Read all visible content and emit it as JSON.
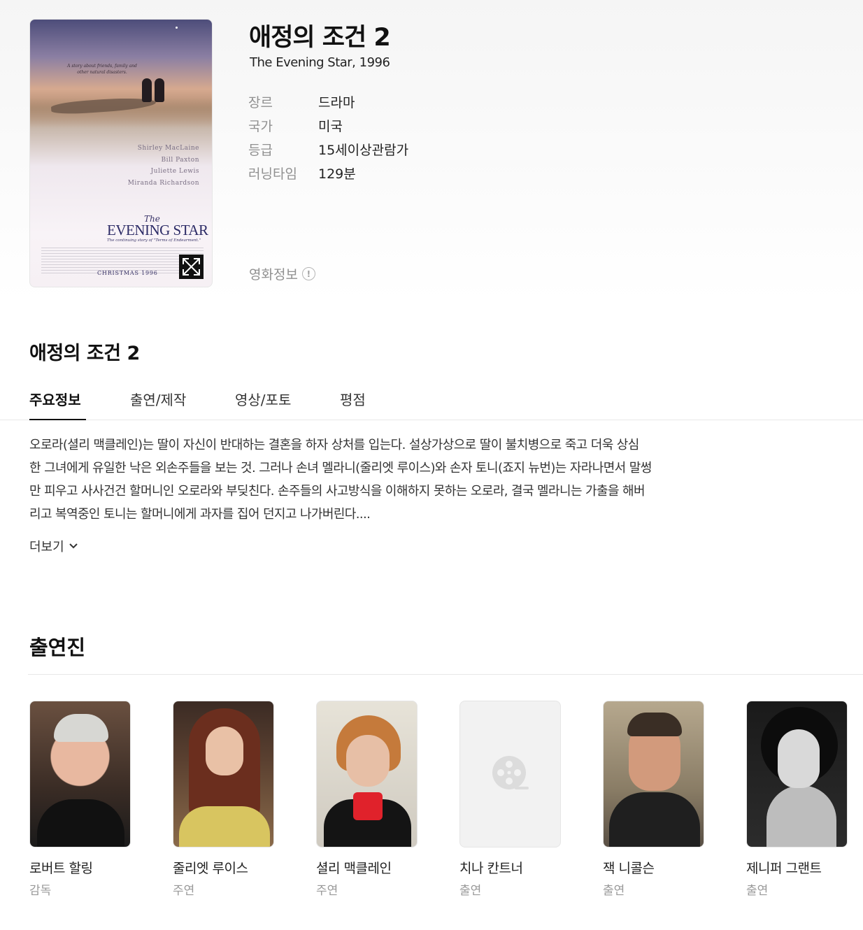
{
  "movie": {
    "title_ko": "애정의 조건 2",
    "title_en_year": "The Evening Star, 1996",
    "info": [
      {
        "key": "장르",
        "value": "드라마"
      },
      {
        "key": "국가",
        "value": "미국"
      },
      {
        "key": "등급",
        "value": "15세이상관람가"
      },
      {
        "key": "러닝타임",
        "value": "129분"
      }
    ],
    "movie_info_label": "영화정보",
    "info_icon": "!"
  },
  "poster": {
    "tagline": "A story about friends, family and other natural disasters.",
    "credits": [
      "Shirley MacLaine",
      "Bill Paxton",
      "Juliette Lewis",
      "Miranda Richardson"
    ],
    "logo_the": "The",
    "logo_main": "EVENING STAR",
    "logo_sub": "The continuing story of \"Terms of Endearment.\"",
    "release": "CHRISTMAS 1996"
  },
  "section_title": "애정의 조건 2",
  "tabs": [
    {
      "label": "주요정보",
      "active": true
    },
    {
      "label": "출연/제작",
      "active": false
    },
    {
      "label": "영상/포토",
      "active": false
    },
    {
      "label": "평점",
      "active": false
    }
  ],
  "synopsis": {
    "lines": [
      "오로라(셜리 맥클레인)는 딸이 자신이 반대하는 결혼을 하자 상처를 입는다. 설상가상으로 딸이 불치병으로 죽고 더욱 상심",
      "한 그녀에게 유일한 낙은 외손주들을 보는 것. 그러나 손녀 멜라니(줄리엣 루이스)와 손자 토니(죠지 뉴번)는 자라나면서 말썽",
      "만 피우고 사사건건 할머니인 오로라와 부딪친다. 손주들의 사고방식을 이해하지 못하는 오로라, 결국 멜라니는 가출을 해버",
      "리고 복역중인 토니는 할머니에게 과자를 집어 던지고 나가버린다...."
    ],
    "more_label": "더보기"
  },
  "cast": {
    "title": "출연진",
    "members": [
      {
        "name": "로버트 할링",
        "role": "감독"
      },
      {
        "name": "줄리엣 루이스",
        "role": "주연"
      },
      {
        "name": "셜리 맥클레인",
        "role": "주연"
      },
      {
        "name": "치나 칸트너",
        "role": "출연"
      },
      {
        "name": "잭 니콜슨",
        "role": "출연"
      },
      {
        "name": "제니퍼 그랜트",
        "role": "출연"
      }
    ]
  },
  "icons": {
    "expand": "expand-icon",
    "chevron": "chevron-down-icon",
    "film_placeholder": "film-reel-icon"
  }
}
